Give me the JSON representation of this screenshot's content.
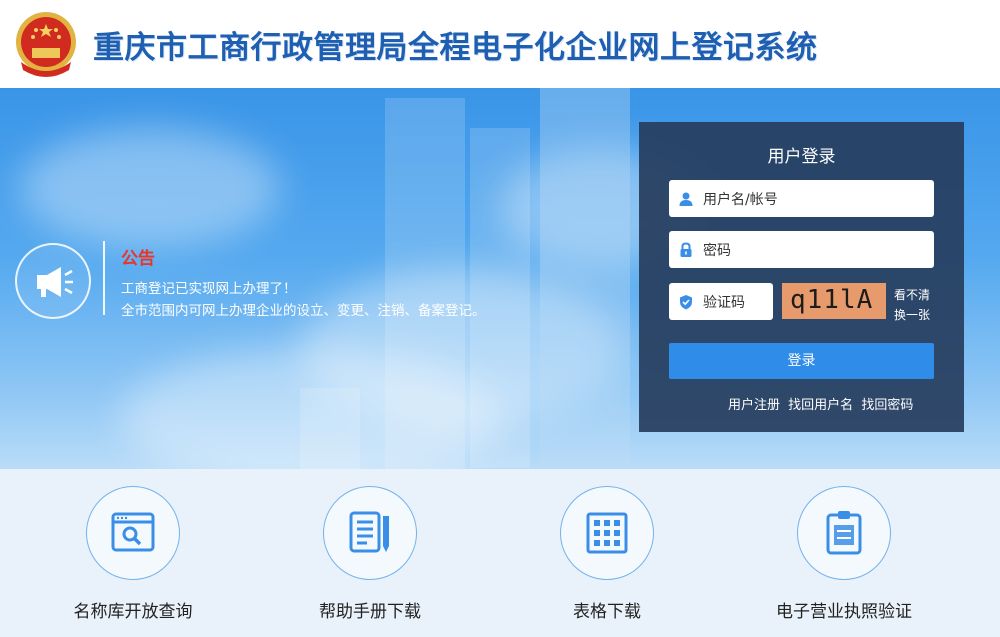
{
  "header": {
    "title": "重庆市工商行政管理局全程电子化企业网上登记系统",
    "emblem_icon": "national-emblem-icon"
  },
  "notice": {
    "icon": "megaphone-icon",
    "title": "公告",
    "line1": "工商登记已实现网上办理了！",
    "line2": "全市范围内可网上办理企业的设立、变更、注销、备案登记。"
  },
  "login": {
    "title": "用户登录",
    "username_placeholder": "用户名/帐号",
    "password_placeholder": "密码",
    "captcha_placeholder": "验证码",
    "captcha_text": "q11lA",
    "refresh_line1": "看不清",
    "refresh_line2": "换一张",
    "submit_label": "登录",
    "register_link": "用户注册",
    "find_username_link": "找回用户名",
    "find_password_link": "找回密码"
  },
  "services": [
    {
      "label": "名称库开放查询",
      "icon": "search-window-icon"
    },
    {
      "label": "帮助手册下载",
      "icon": "document-pen-icon"
    },
    {
      "label": "表格下载",
      "icon": "grid-table-icon"
    },
    {
      "label": "电子营业执照验证",
      "icon": "business-license-icon"
    }
  ],
  "colors": {
    "title_blue": "#1f5fb2",
    "notice_red": "#e8352a",
    "panel_bg": "#263d5d",
    "button_blue": "#2f8ce8",
    "icon_blue": "#3a8ee6"
  }
}
